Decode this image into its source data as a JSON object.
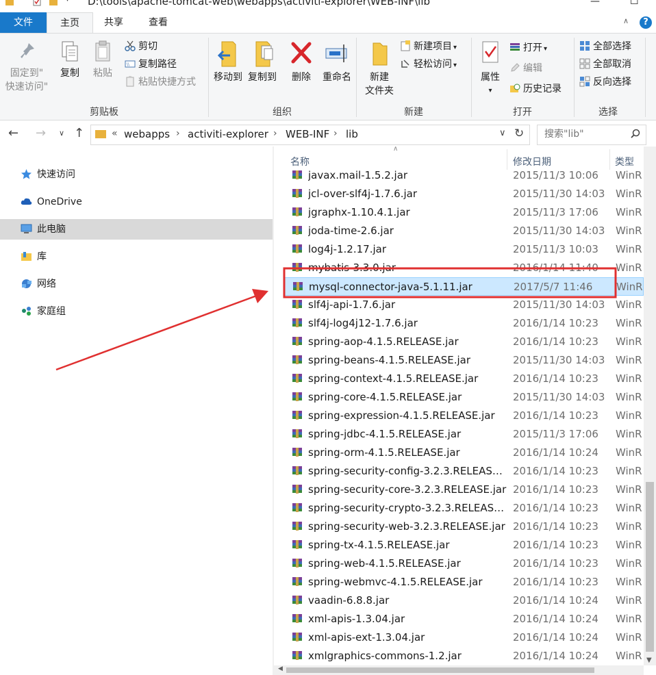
{
  "window": {
    "title": "D:\\tools\\apache-tomcat-web\\webapps\\activiti-explorer\\WEB-INF\\lib",
    "minimize_glyph": "—",
    "maximize_glyph": "☐"
  },
  "ribbon_tabs": {
    "file": "文件",
    "home": "主页",
    "share": "共享",
    "view": "查看",
    "help_glyph": "?"
  },
  "ribbon": {
    "clipboard": {
      "label": "剪贴板",
      "pin_label": "固定到\"",
      "pin_label2": "快速访问\"",
      "copy": "复制",
      "paste": "粘贴",
      "cut": "剪切",
      "copy_path": "复制路径",
      "paste_shortcut": "粘贴快捷方式"
    },
    "organize": {
      "label": "组织",
      "move_to": "移动到",
      "copy_to": "复制到",
      "delete": "删除",
      "rename": "重命名"
    },
    "new": {
      "label": "新建",
      "new_folder": "新建",
      "new_folder2": "文件夹",
      "new_item": "新建项目",
      "easy_access": "轻松访问"
    },
    "open": {
      "label": "打开",
      "properties": "属性",
      "open": "打开",
      "edit": "编辑",
      "history": "历史记录"
    },
    "select": {
      "label": "选择",
      "select_all": "全部选择",
      "select_none": "全部取消",
      "invert": "反向选择"
    }
  },
  "address": {
    "overflow": "«",
    "crumbs": [
      "webapps",
      "activiti-explorer",
      "WEB-INF",
      "lib"
    ],
    "search_placeholder": "搜索\"lib\""
  },
  "nav_pane": {
    "items": [
      {
        "label": "快速访问",
        "icon": "star-icon"
      },
      {
        "label": "OneDrive",
        "icon": "cloud-icon"
      },
      {
        "label": "此电脑",
        "icon": "computer-icon",
        "selected": true
      },
      {
        "label": "库",
        "icon": "library-icon"
      },
      {
        "label": "网络",
        "icon": "network-icon"
      },
      {
        "label": "家庭组",
        "icon": "homegroup-icon"
      }
    ]
  },
  "file_list": {
    "columns": {
      "name": "名称",
      "date": "修改日期",
      "type": "类型"
    },
    "rows": [
      {
        "name": "javax.mail-1.5.2.jar",
        "date": "2015/11/3 10:06",
        "type": "WinR"
      },
      {
        "name": "jcl-over-slf4j-1.7.6.jar",
        "date": "2015/11/30 14:03",
        "type": "WinR"
      },
      {
        "name": "jgraphx-1.10.4.1.jar",
        "date": "2015/11/3 17:06",
        "type": "WinR"
      },
      {
        "name": "joda-time-2.6.jar",
        "date": "2015/11/30 14:03",
        "type": "WinR"
      },
      {
        "name": "log4j-1.2.17.jar",
        "date": "2015/11/3 10:03",
        "type": "WinR"
      },
      {
        "name": "mybatis-3.3.0.jar",
        "date": "2016/1/14 11:40",
        "type": "WinR"
      },
      {
        "name": "mysql-connector-java-5.1.11.jar",
        "date": "2017/5/7 11:46",
        "type": "WinR",
        "selected": true
      },
      {
        "name": "slf4j-api-1.7.6.jar",
        "date": "2015/11/30 14:03",
        "type": "WinR"
      },
      {
        "name": "slf4j-log4j12-1.7.6.jar",
        "date": "2016/1/14 10:23",
        "type": "WinR"
      },
      {
        "name": "spring-aop-4.1.5.RELEASE.jar",
        "date": "2016/1/14 10:23",
        "type": "WinR"
      },
      {
        "name": "spring-beans-4.1.5.RELEASE.jar",
        "date": "2015/11/30 14:03",
        "type": "WinR"
      },
      {
        "name": "spring-context-4.1.5.RELEASE.jar",
        "date": "2016/1/14 10:23",
        "type": "WinR"
      },
      {
        "name": "spring-core-4.1.5.RELEASE.jar",
        "date": "2015/11/30 14:03",
        "type": "WinR"
      },
      {
        "name": "spring-expression-4.1.5.RELEASE.jar",
        "date": "2016/1/14 10:23",
        "type": "WinR"
      },
      {
        "name": "spring-jdbc-4.1.5.RELEASE.jar",
        "date": "2015/11/3 17:06",
        "type": "WinR"
      },
      {
        "name": "spring-orm-4.1.5.RELEASE.jar",
        "date": "2016/1/14 10:24",
        "type": "WinR"
      },
      {
        "name": "spring-security-config-3.2.3.RELEASE...",
        "date": "2016/1/14 10:23",
        "type": "WinR"
      },
      {
        "name": "spring-security-core-3.2.3.RELEASE.jar",
        "date": "2016/1/14 10:23",
        "type": "WinR"
      },
      {
        "name": "spring-security-crypto-3.2.3.RELEASE...",
        "date": "2016/1/14 10:23",
        "type": "WinR"
      },
      {
        "name": "spring-security-web-3.2.3.RELEASE.jar",
        "date": "2016/1/14 10:23",
        "type": "WinR"
      },
      {
        "name": "spring-tx-4.1.5.RELEASE.jar",
        "date": "2016/1/14 10:23",
        "type": "WinR"
      },
      {
        "name": "spring-web-4.1.5.RELEASE.jar",
        "date": "2016/1/14 10:23",
        "type": "WinR"
      },
      {
        "name": "spring-webmvc-4.1.5.RELEASE.jar",
        "date": "2016/1/14 10:23",
        "type": "WinR"
      },
      {
        "name": "vaadin-6.8.8.jar",
        "date": "2016/1/14 10:24",
        "type": "WinR"
      },
      {
        "name": "xml-apis-1.3.04.jar",
        "date": "2016/1/14 10:24",
        "type": "WinR"
      },
      {
        "name": "xml-apis-ext-1.3.04.jar",
        "date": "2016/1/14 10:24",
        "type": "WinR"
      },
      {
        "name": "xmlgraphics-commons-1.2.jar",
        "date": "2016/1/14 10:24",
        "type": "WinR"
      }
    ]
  },
  "colors": {
    "accent": "#1979ca",
    "selection_bg": "#cce8ff",
    "annotation_red": "#e03030"
  }
}
